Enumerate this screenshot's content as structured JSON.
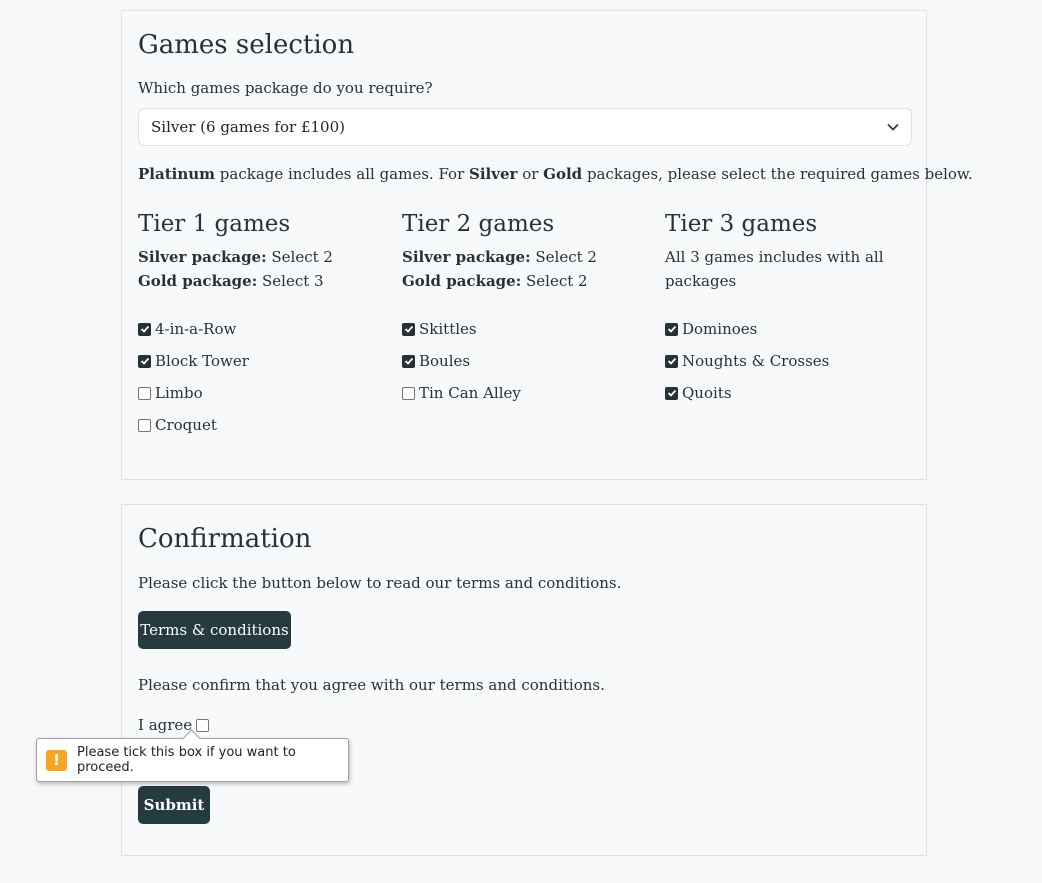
{
  "games": {
    "title": "Games selection",
    "question": "Which games package do you require?",
    "select_value": "Silver (6 games for £100)",
    "note": {
      "b1": "Platinum",
      "t1": " package includes all games. For ",
      "b2": "Silver",
      "t2": " or ",
      "b3": "Gold",
      "t3": " packages, please select the required games below."
    },
    "tiers": [
      {
        "title": "Tier 1 games",
        "silver_label": "Silver package:",
        "silver_value": " Select 2",
        "gold_label": "Gold package:",
        "gold_value": " Select 3",
        "options": [
          {
            "label": "4-in-a-Row",
            "checked": true
          },
          {
            "label": "Block Tower",
            "checked": true
          },
          {
            "label": "Limbo",
            "checked": false
          },
          {
            "label": "Croquet",
            "checked": false
          }
        ]
      },
      {
        "title": "Tier 2 games",
        "silver_label": "Silver package:",
        "silver_value": " Select 2",
        "gold_label": "Gold package:",
        "gold_value": " Select 2",
        "options": [
          {
            "label": "Skittles",
            "checked": true
          },
          {
            "label": "Boules",
            "checked": true
          },
          {
            "label": "Tin Can Alley",
            "checked": false
          }
        ]
      },
      {
        "title": "Tier 3 games",
        "note": "All 3 games includes with all packages",
        "options": [
          {
            "label": "Dominoes",
            "checked": true
          },
          {
            "label": "Noughts & Crosses",
            "checked": true
          },
          {
            "label": "Quoits",
            "checked": true
          }
        ]
      }
    ]
  },
  "confirmation": {
    "title": "Confirmation",
    "intro": "Please click the button below to read our terms and conditions.",
    "tc_button": "Terms & conditions",
    "confirm_text": "Please confirm that you agree with our terms and conditions.",
    "agree_label": "I agree",
    "agree_checked": false,
    "submit_button": "Submit",
    "tooltip": "Please tick this box if you want to proceed.",
    "tooltip_icon": "warning-icon"
  },
  "colors": {
    "accent": "#263b3f",
    "warning": "#f5a623"
  }
}
